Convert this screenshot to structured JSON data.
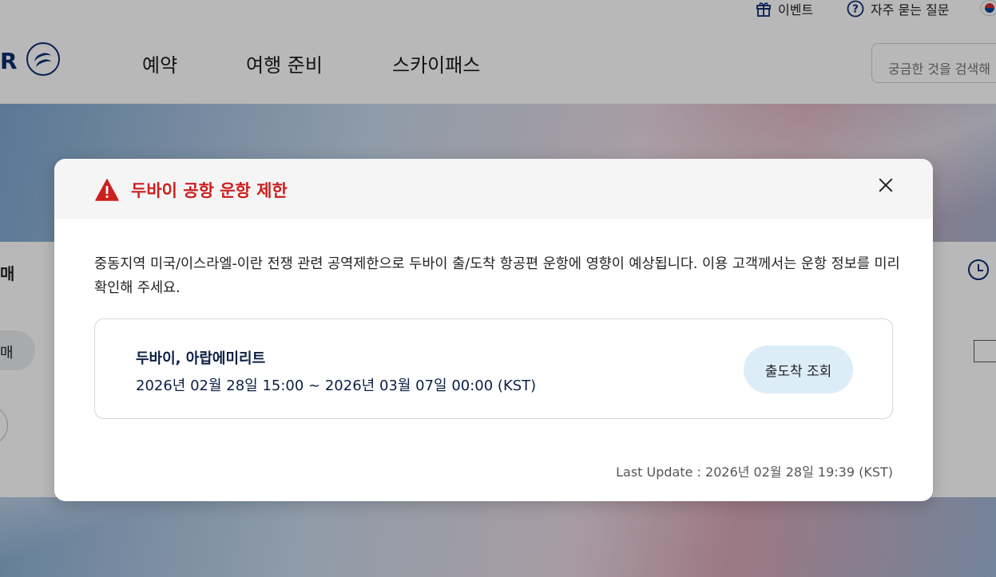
{
  "utility": {
    "events_label": "이벤트",
    "faq_label": "자주 묻는 질문"
  },
  "header": {
    "logo_letter": "R",
    "nav": [
      "예약",
      "여행 준비",
      "스카이패스"
    ],
    "search_placeholder": "궁금한 것을 검색해"
  },
  "background": {
    "panel_label": "매",
    "pill_label": "매"
  },
  "modal": {
    "title": "두바이 공항 운항 제한",
    "message": "중동지역 미국/이스라엘-이란 전쟁 관련 공역제한으로 두바이 출/도착 항공편 운항에 영향이 예상됩니다. 이용 고객께서는 운항 정보를 미리 확인해 주세요.",
    "card": {
      "location": "두바이, 아랍에미리트",
      "period": "2026년 02월 28일 15:00 ~ 2026년 03월 07일 00:00 (KST)",
      "button_label": "출도착 조회"
    },
    "last_update": "Last Update : 2026년 02월 28일 19:39 (KST)"
  },
  "colors": {
    "title_red": "#cc1f1f",
    "brand_navy": "#0b2d71",
    "button_bg": "#dcedf8"
  },
  "icons": {
    "warning": "warning-triangle-icon",
    "close": "close-icon",
    "gift": "gift-icon",
    "help": "question-circle-icon",
    "clock": "clock-icon",
    "flag": "korea-flag-icon"
  }
}
